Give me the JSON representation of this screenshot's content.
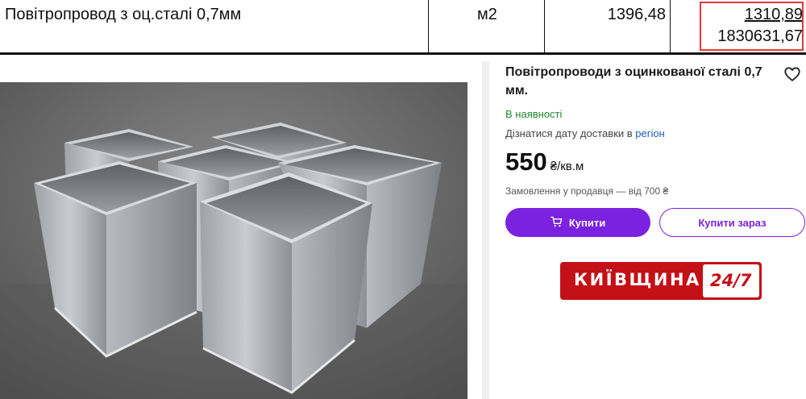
{
  "sheet": {
    "item_name": "Повітропровод з оц.сталі 0,7мм",
    "unit": "м2",
    "quantity": "1396,48",
    "unit_price": "1310,89",
    "total": "1830631,67"
  },
  "product": {
    "title": "Повітропроводи з оцинкованої сталі 0,7 мм.",
    "availability": "В наявності",
    "delivery_prefix": "Дізнатися дату доставки в",
    "delivery_region": "регіон",
    "price": "550",
    "price_unit": "₴/кв.м",
    "seller_note": "Замовлення у продавця — від 700 ₴",
    "buy_label": "Купити",
    "buy_now_label": "Купити зараз",
    "favorite_icon": "heart-icon",
    "cart_icon": "cart-icon"
  },
  "logo": {
    "text": "КИЇВЩИНА",
    "badge": "24/7"
  },
  "colors": {
    "accent": "#7b22e0",
    "in_stock": "#1e8a2a",
    "link": "#1a5fb4",
    "highlight": "#e53935",
    "logo_red": "#c41017"
  }
}
